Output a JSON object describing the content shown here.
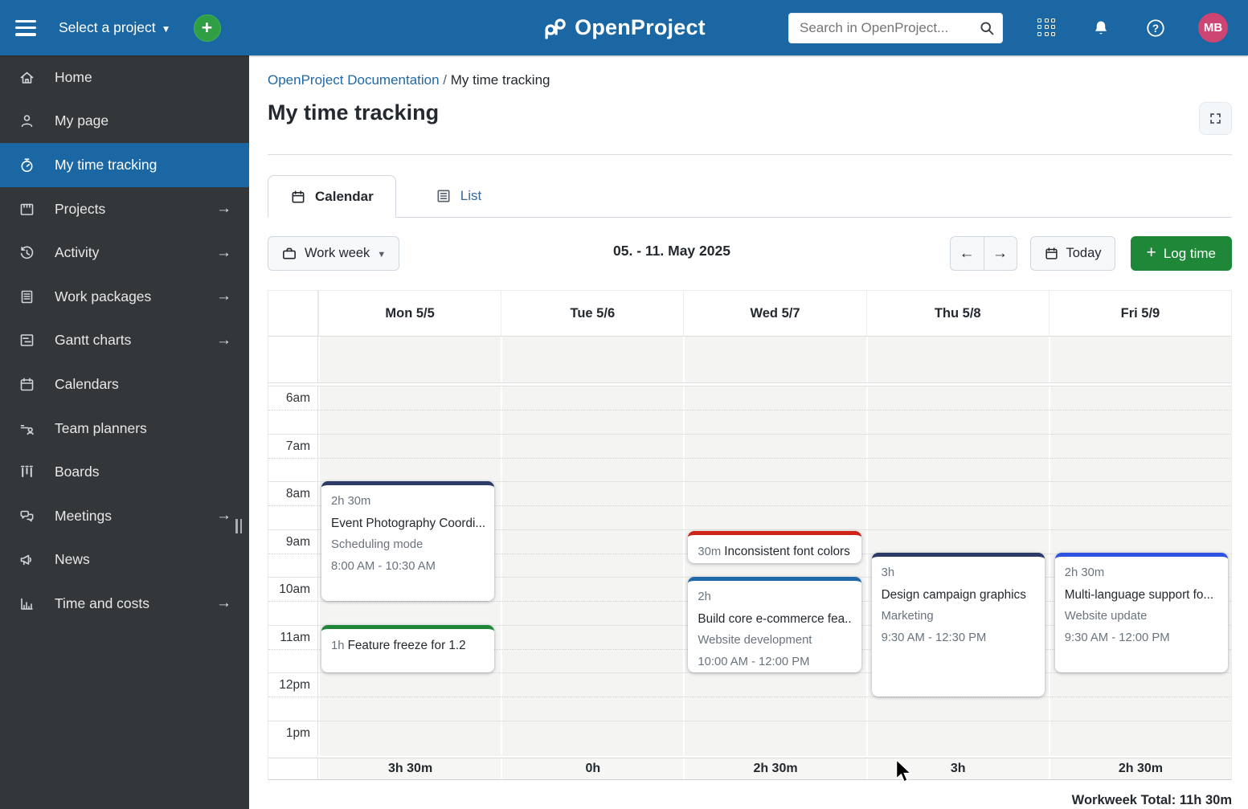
{
  "topbar": {
    "project_selector_label": "Select a project",
    "logo_text": "OpenProject",
    "search_placeholder": "Search in OpenProject...",
    "avatar_initials": "MB"
  },
  "sidebar": {
    "items": [
      {
        "label": "Home",
        "active": false
      },
      {
        "label": "My page",
        "active": false
      },
      {
        "label": "My time tracking",
        "active": true
      },
      {
        "label": "Projects",
        "arrow": true
      },
      {
        "label": "Activity",
        "arrow": true
      },
      {
        "label": "Work packages",
        "arrow": true
      },
      {
        "label": "Gantt charts",
        "arrow": true
      },
      {
        "label": "Calendars"
      },
      {
        "label": "Team planners"
      },
      {
        "label": "Boards"
      },
      {
        "label": "Meetings",
        "arrow": true
      },
      {
        "label": "News"
      },
      {
        "label": "Time and costs",
        "arrow": true
      }
    ]
  },
  "breadcrumb": {
    "parent": "OpenProject Documentation",
    "separator": "/",
    "current": "My time tracking"
  },
  "page_title": "My time tracking",
  "tabs": {
    "calendar": "Calendar",
    "list": "List"
  },
  "toolbar": {
    "view_mode": "Work week",
    "date_range": "05. - 11. May 2025",
    "today_label": "Today",
    "log_time_label": "Log time"
  },
  "calendar": {
    "days": [
      {
        "label": "Mon 5/5",
        "total": "3h 30m"
      },
      {
        "label": "Tue 5/6",
        "total": "0h"
      },
      {
        "label": "Wed 5/7",
        "total": "2h 30m"
      },
      {
        "label": "Thu 5/8",
        "total": "3h"
      },
      {
        "label": "Fri 5/9",
        "total": "2h 30m"
      }
    ],
    "times": [
      "6am",
      "7am",
      "8am",
      "9am",
      "10am",
      "11am",
      "12pm",
      "1pm"
    ],
    "events": [
      {
        "day": 0,
        "start": 8,
        "end": 10.5,
        "duration": "2h 30m",
        "title": "Event Photography Coordi...",
        "subtitle": "Scheduling mode",
        "time": "8:00 AM - 10:30 AM",
        "color": "#2B3A67"
      },
      {
        "day": 0,
        "start": 11,
        "end": 12,
        "duration": "1h",
        "title": "Feature freeze for 1.2",
        "color": "#1F8838"
      },
      {
        "day": 2,
        "start": 9.05,
        "end": 9.55,
        "duration": "30m",
        "title": "Inconsistent font colors",
        "color": "#CE2418"
      },
      {
        "day": 2,
        "start": 10,
        "end": 12,
        "duration": "2h",
        "title": "Build core e-commerce fea...",
        "subtitle": "Website development",
        "time": "10:00 AM - 12:00 PM",
        "color": "#1F68A8"
      },
      {
        "day": 3,
        "start": 9.5,
        "end": 12.5,
        "duration": "3h",
        "title": "Design campaign graphics",
        "subtitle": "Marketing",
        "time": "9:30 AM - 12:30 PM",
        "color": "#2B3A67"
      },
      {
        "day": 4,
        "start": 9.5,
        "end": 12,
        "duration": "2h 30m",
        "title": "Multi-language support fo...",
        "subtitle": "Website update",
        "time": "9:30 AM - 12:00 PM",
        "color": "#2E53E2"
      }
    ],
    "workweek_total_label": "Workweek Total:",
    "workweek_total_value": "11h 30m"
  }
}
